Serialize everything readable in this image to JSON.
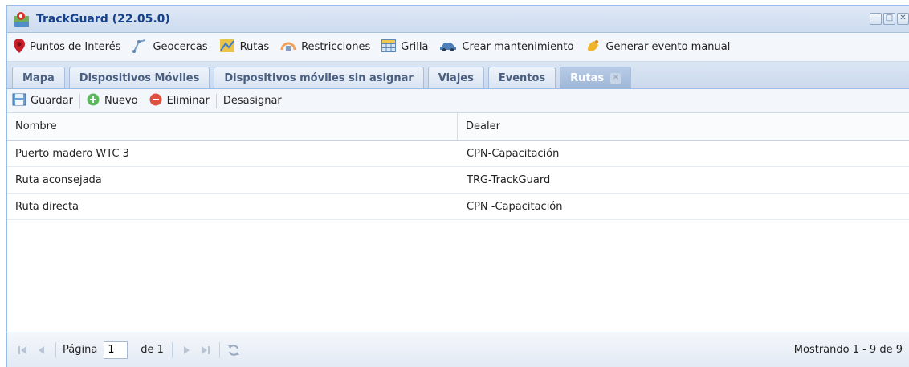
{
  "window": {
    "title": "TrackGuard (22.05.0)",
    "controls": [
      "minimize",
      "maximize",
      "close"
    ]
  },
  "toolbar": {
    "items": [
      {
        "label": "Puntos de Interés",
        "icon": "map-pin-icon"
      },
      {
        "label": "Geocercas",
        "icon": "geofence-icon"
      },
      {
        "label": "Rutas",
        "icon": "route-map-icon"
      },
      {
        "label": "Restricciones",
        "icon": "restriction-icon"
      },
      {
        "label": "Grilla",
        "icon": "grid-icon"
      },
      {
        "label": "Crear mantenimiento",
        "icon": "car-icon"
      },
      {
        "label": "Generar evento manual",
        "icon": "bell-icon"
      }
    ]
  },
  "tabs": [
    {
      "label": "Mapa"
    },
    {
      "label": "Dispositivos Móviles"
    },
    {
      "label": "Dispositivos móviles sin asignar"
    },
    {
      "label": "Viajes"
    },
    {
      "label": "Eventos"
    },
    {
      "label": "Rutas",
      "active": true
    }
  ],
  "actions": {
    "save_label": "Guardar",
    "new_label": "Nuevo",
    "delete_label": "Eliminar",
    "unassign_label": "Desasignar"
  },
  "grid": {
    "columns": [
      "Nombre",
      "Dealer"
    ],
    "rows": [
      [
        "Puerto madero WTC 3",
        "CPN-Capacitación"
      ],
      [
        "Ruta aconsejada",
        "TRG-TrackGuard"
      ],
      [
        "Ruta directa",
        "CPN -Capacitación"
      ]
    ]
  },
  "pager": {
    "page_label": "Página",
    "page_value": "1",
    "of_label": "de 1",
    "status": "Mostrando 1 - 9 de 9"
  },
  "colors": {
    "accent": "#15428b",
    "tab_active": "#9fb7d8",
    "border": "#99bbe8"
  }
}
